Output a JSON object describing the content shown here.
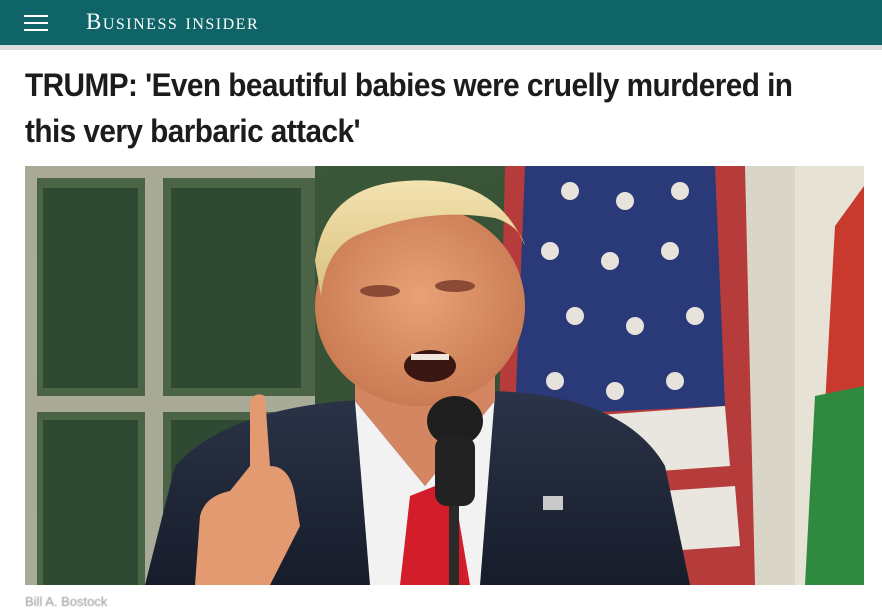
{
  "header": {
    "logo_text": "Business Insider",
    "menu_icon": "hamburger-menu-icon",
    "background_color": "#0f6468"
  },
  "article": {
    "headline": "TRUMP: 'Even beautiful babies were cruelly murdered in this very barbaric attack'",
    "hero_image_subject": "man speaking at microphone, pointing finger up, flag in background",
    "byline": "Bill A. Bostock"
  }
}
